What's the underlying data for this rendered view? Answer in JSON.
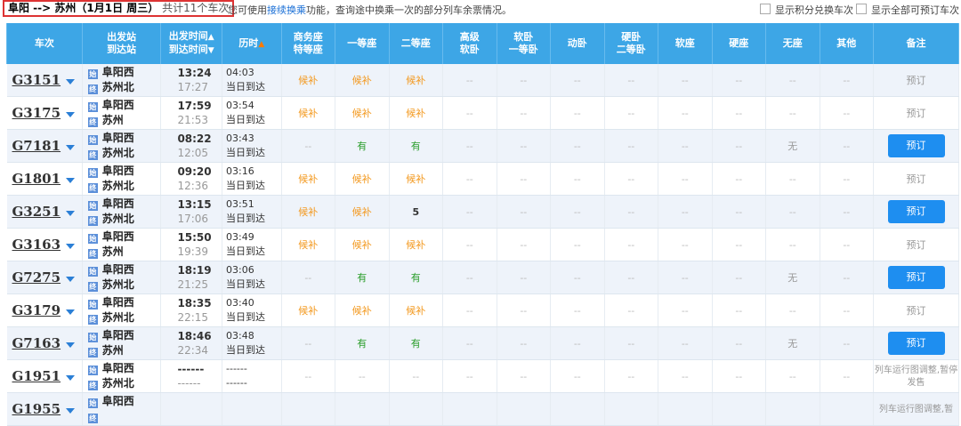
{
  "header": {
    "route": "阜阳 --> 苏州（1月1日 周三）",
    "count_text": "共计11个车次",
    "tip_prefix": "您可使用",
    "tip_link": "接续换乘",
    "tip_suffix": "功能，查询途中换乘一次的部分列车余票情况。",
    "opt_points": "显示积分兑换车次",
    "opt_all": "显示全部可预订车次"
  },
  "columns": {
    "train": "车次",
    "from_station": "出发站",
    "to_station": "到达站",
    "dep_time": "出发时间",
    "arr_time": "到达时间",
    "duration": "历时",
    "business": "商务座",
    "special": "特等座",
    "first": "一等座",
    "second": "二等座",
    "hs1": "高级",
    "hs2": "软卧",
    "sb1": "软卧",
    "sb2": "一等卧",
    "dw": "动卧",
    "hb1": "硬卧",
    "hb2": "二等卧",
    "rz": "软座",
    "yz": "硬座",
    "wz": "无座",
    "qt": "其他",
    "remark": "备注"
  },
  "trains": [
    {
      "no": "G3151",
      "from": "阜阳西",
      "to": "苏州北",
      "dep": "13:24",
      "arr": "17:27",
      "dur": "04:03",
      "day": "当日到达",
      "sw": "候补",
      "yd": "候补",
      "ed": "候补",
      "gr": "--",
      "rw": "--",
      "dw": "--",
      "yw": "--",
      "rz": "--",
      "yz": "--",
      "wz": "--",
      "qt": "--",
      "remark": "预订",
      "bookable": false
    },
    {
      "no": "G3175",
      "from": "阜阳西",
      "to": "苏州",
      "dep": "17:59",
      "arr": "21:53",
      "dur": "03:54",
      "day": "当日到达",
      "sw": "候补",
      "yd": "候补",
      "ed": "候补",
      "gr": "--",
      "rw": "--",
      "dw": "--",
      "yw": "--",
      "rz": "--",
      "yz": "--",
      "wz": "--",
      "qt": "--",
      "remark": "预订",
      "bookable": false
    },
    {
      "no": "G7181",
      "from": "阜阳西",
      "to": "苏州北",
      "dep": "08:22",
      "arr": "12:05",
      "dur": "03:43",
      "day": "当日到达",
      "sw": "--",
      "yd": "有",
      "ed": "有",
      "gr": "--",
      "rw": "--",
      "dw": "--",
      "yw": "--",
      "rz": "--",
      "yz": "--",
      "wz": "无",
      "qt": "--",
      "remark": "预订",
      "bookable": true
    },
    {
      "no": "G1801",
      "from": "阜阳西",
      "to": "苏州北",
      "dep": "09:20",
      "arr": "12:36",
      "dur": "03:16",
      "day": "当日到达",
      "sw": "候补",
      "yd": "候补",
      "ed": "候补",
      "gr": "--",
      "rw": "--",
      "dw": "--",
      "yw": "--",
      "rz": "--",
      "yz": "--",
      "wz": "--",
      "qt": "--",
      "remark": "预订",
      "bookable": false
    },
    {
      "no": "G3251",
      "from": "阜阳西",
      "to": "苏州北",
      "dep": "13:15",
      "arr": "17:06",
      "dur": "03:51",
      "day": "当日到达",
      "sw": "候补",
      "yd": "候补",
      "ed": "5",
      "gr": "--",
      "rw": "--",
      "dw": "--",
      "yw": "--",
      "rz": "--",
      "yz": "--",
      "wz": "--",
      "qt": "--",
      "remark": "预订",
      "bookable": true
    },
    {
      "no": "G3163",
      "from": "阜阳西",
      "to": "苏州",
      "dep": "15:50",
      "arr": "19:39",
      "dur": "03:49",
      "day": "当日到达",
      "sw": "候补",
      "yd": "候补",
      "ed": "候补",
      "gr": "--",
      "rw": "--",
      "dw": "--",
      "yw": "--",
      "rz": "--",
      "yz": "--",
      "wz": "--",
      "qt": "--",
      "remark": "预订",
      "bookable": false
    },
    {
      "no": "G7275",
      "from": "阜阳西",
      "to": "苏州北",
      "dep": "18:19",
      "arr": "21:25",
      "dur": "03:06",
      "day": "当日到达",
      "sw": "--",
      "yd": "有",
      "ed": "有",
      "gr": "--",
      "rw": "--",
      "dw": "--",
      "yw": "--",
      "rz": "--",
      "yz": "--",
      "wz": "无",
      "qt": "--",
      "remark": "预订",
      "bookable": true
    },
    {
      "no": "G3179",
      "from": "阜阳西",
      "to": "苏州北",
      "dep": "18:35",
      "arr": "22:15",
      "dur": "03:40",
      "day": "当日到达",
      "sw": "候补",
      "yd": "候补",
      "ed": "候补",
      "gr": "--",
      "rw": "--",
      "dw": "--",
      "yw": "--",
      "rz": "--",
      "yz": "--",
      "wz": "--",
      "qt": "--",
      "remark": "预订",
      "bookable": false
    },
    {
      "no": "G7163",
      "from": "阜阳西",
      "to": "苏州",
      "dep": "18:46",
      "arr": "22:34",
      "dur": "03:48",
      "day": "当日到达",
      "sw": "--",
      "yd": "有",
      "ed": "有",
      "gr": "--",
      "rw": "--",
      "dw": "--",
      "yw": "--",
      "rz": "--",
      "yz": "--",
      "wz": "无",
      "qt": "--",
      "remark": "预订",
      "bookable": true
    },
    {
      "no": "G1951",
      "from": "阜阳西",
      "to": "苏州北",
      "dep": "------",
      "arr": "------",
      "dur": "------",
      "day": "------",
      "sw": "--",
      "yd": "--",
      "ed": "--",
      "gr": "--",
      "rw": "--",
      "dw": "--",
      "yw": "--",
      "rz": "--",
      "yz": "--",
      "wz": "--",
      "qt": "--",
      "remark": "列车运行图调整,暂停发售",
      "bookable": false
    },
    {
      "no": "G1955",
      "from": "阜阳西",
      "to": "",
      "dep": "",
      "arr": "",
      "dur": "",
      "day": "",
      "sw": "",
      "yd": "",
      "ed": "",
      "gr": "",
      "rw": "",
      "dw": "",
      "yw": "",
      "rz": "",
      "yz": "",
      "wz": "",
      "qt": "",
      "remark": "列车运行图调整,暂",
      "bookable": false
    }
  ],
  "colors": {
    "header_bg": "#3da6e6",
    "book_btn": "#1e8ef0",
    "waitlist": "#f39a21",
    "available": "#2a9d2a"
  },
  "icons": {
    "station": "station-icon",
    "dropdown": "chevron-down-icon"
  }
}
